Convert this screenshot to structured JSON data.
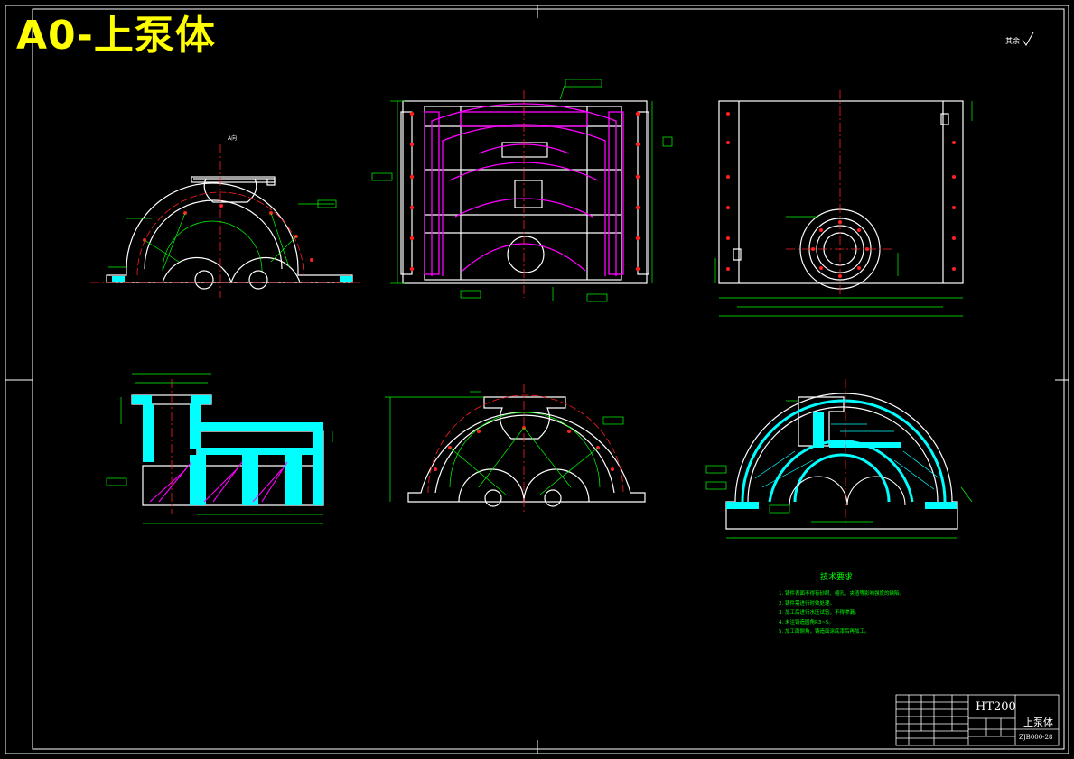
{
  "drawing": {
    "title": "A0-上泵体",
    "roughness_note": "其余"
  },
  "views": {
    "top_left_label": "A向"
  },
  "technical_requirements": {
    "heading": "技术要求",
    "items": [
      "1. 铸件表面不得有砂眼、缩孔、夹渣等影响强度的缺陷。",
      "2. 铸件需进行时效处理。",
      "3. 加工后进行水压试验，不得渗漏。",
      "4. 未注铸造圆角R3~5。",
      "5. 加工面倒角，铸造面涂底漆后再加工。"
    ]
  },
  "title_block": {
    "material": "HT200",
    "part_name": "上泵体",
    "drawing_code": "ZJB000-28"
  },
  "colors": {
    "outline": "#ffffff",
    "dimension": "#00ff00",
    "center": "#ff2020",
    "hidden": "#ff00ff",
    "hatch": "#00ffff",
    "title": "#ffff00"
  }
}
